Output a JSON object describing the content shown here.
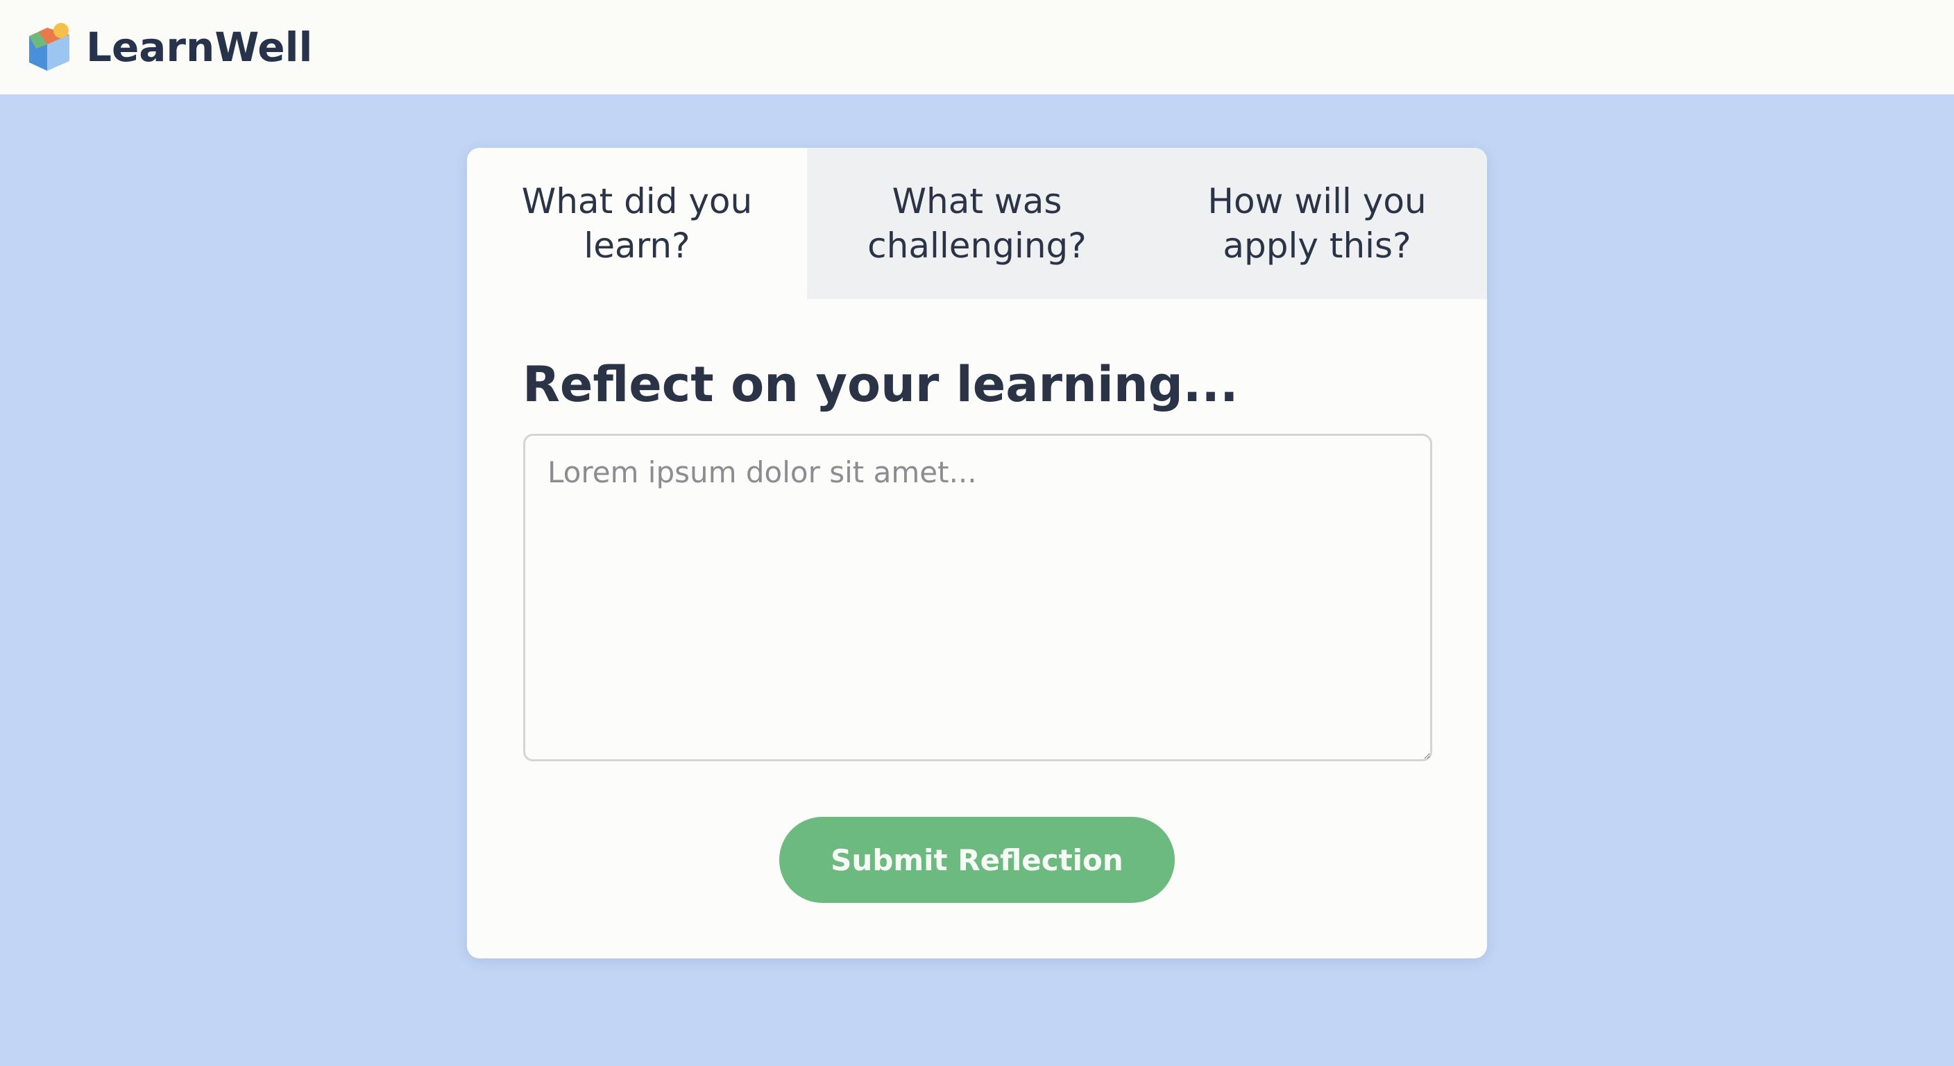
{
  "app": {
    "brand": "LearnWell",
    "logo_icon": "cube-learning-icon"
  },
  "tabs": [
    {
      "label": "What did you learn?",
      "active": true
    },
    {
      "label": "What was challenging?",
      "active": false
    },
    {
      "label": "How will you apply this?",
      "active": false
    }
  ],
  "main": {
    "heading": "Reflect on your learning...",
    "input": {
      "placeholder": "Lorem ipsum dolor sit amet...",
      "value": ""
    },
    "submit_label": "Submit Reflection"
  },
  "colors": {
    "page_background": "#c2d5f5",
    "submit_button": "#6dba80",
    "heading_text": "#2a3446"
  }
}
